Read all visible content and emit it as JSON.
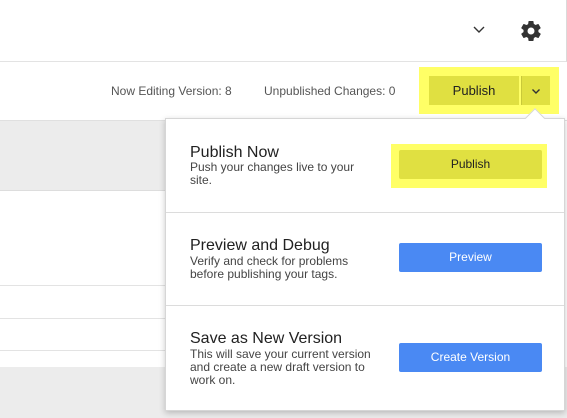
{
  "header": {
    "dropdown_icon": "chevron-down-icon",
    "settings_icon": "gear-icon"
  },
  "toolbar": {
    "editing_version": "Now Editing Version: 8",
    "unpublished_changes": "Unpublished Changes: 0",
    "publish_label": "Publish",
    "publish_menu_icon": "chevron-down-icon"
  },
  "publish_menu": {
    "sections": [
      {
        "title": "Publish Now",
        "description": "Push your changes live to your site.",
        "button": "Publish"
      },
      {
        "title": "Preview and Debug",
        "description": "Verify and check for problems before publishing your tags.",
        "button": "Preview"
      },
      {
        "title": "Save as New Version",
        "description": "This will save your current version and create a new draft version to work on.",
        "button": "Create Version"
      }
    ]
  },
  "colors": {
    "highlight": "#ffff66",
    "publish_button": "#e0e041",
    "primary_button": "#4a89f3"
  }
}
